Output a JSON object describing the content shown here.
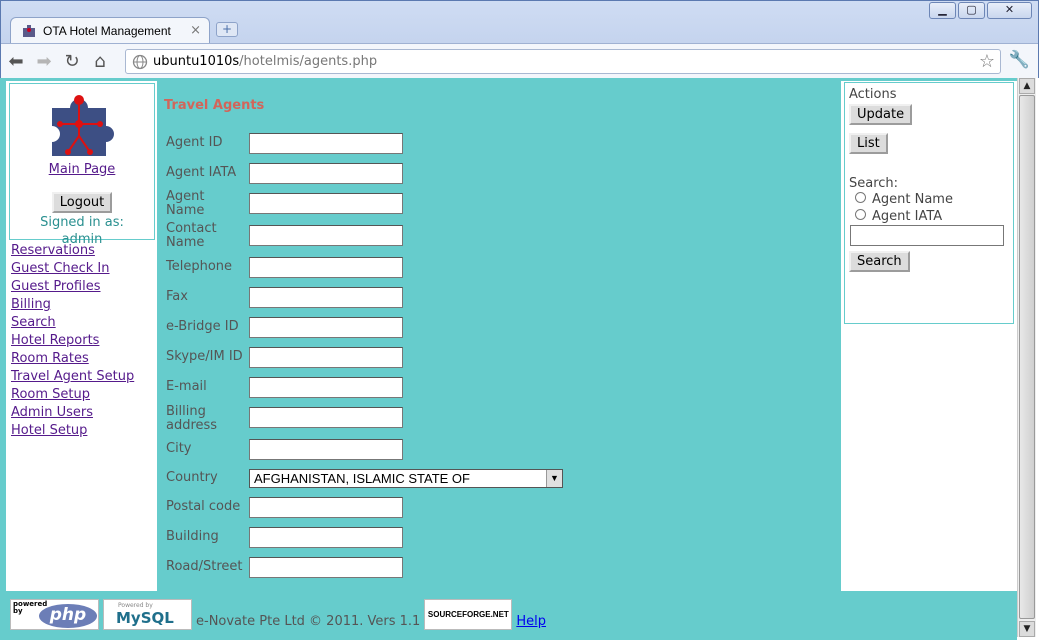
{
  "browser": {
    "tab_title": "OTA Hotel Management",
    "url_host": "ubuntu1010s",
    "url_path": "/hotelmis/agents.php"
  },
  "sidebar": {
    "main_page": "Main Page",
    "logout": "Logout",
    "signed_in_label": "Signed in as:",
    "signed_in_user": "admin",
    "items": [
      {
        "label": "Reservations"
      },
      {
        "label": "Guest Check In"
      },
      {
        "label": "Guest Profiles"
      },
      {
        "label": "Billing"
      },
      {
        "label": "Search"
      },
      {
        "label": "Hotel Reports"
      },
      {
        "label": "Room Rates"
      },
      {
        "label": "Travel Agent Setup"
      },
      {
        "label": "Room Setup"
      },
      {
        "label": "Admin Users"
      },
      {
        "label": "Hotel Setup"
      }
    ]
  },
  "form": {
    "title": "Travel Agents",
    "fields": [
      {
        "label": "Agent ID",
        "value": ""
      },
      {
        "label": "Agent IATA",
        "value": ""
      },
      {
        "label": "Agent Name",
        "value": ""
      },
      {
        "label": "Contact Name",
        "value": ""
      },
      {
        "label": "Telephone",
        "value": ""
      },
      {
        "label": "Fax",
        "value": ""
      },
      {
        "label": "e-Bridge ID",
        "value": ""
      },
      {
        "label": "Skype/IM ID",
        "value": ""
      },
      {
        "label": "E-mail",
        "value": ""
      },
      {
        "label": "Billing address",
        "value": ""
      },
      {
        "label": "City",
        "value": ""
      },
      {
        "label": "Country",
        "value": "AFGHANISTAN, ISLAMIC STATE OF"
      },
      {
        "label": "Postal code",
        "value": ""
      },
      {
        "label": "Building",
        "value": ""
      },
      {
        "label": "Road/Street",
        "value": ""
      }
    ]
  },
  "actions": {
    "title": "Actions",
    "update": "Update",
    "list": "List",
    "search_label": "Search:",
    "radio_agent_name": "Agent Name",
    "radio_agent_iata": "Agent IATA",
    "search_value": "",
    "search_button": "Search"
  },
  "footer": {
    "php_powered": "powered by",
    "php": "php",
    "mysql_powered": "Powered by",
    "mysql": "MySQL",
    "copyright": "e-Novate Pte Ltd © 2011. Vers 1.1",
    "sourceforge": "SOURCEFORGE.NET",
    "help": "Help"
  },
  "colors": {
    "page_bg": "#66cccc",
    "title": "#d2655a",
    "link": "#551a8b"
  }
}
